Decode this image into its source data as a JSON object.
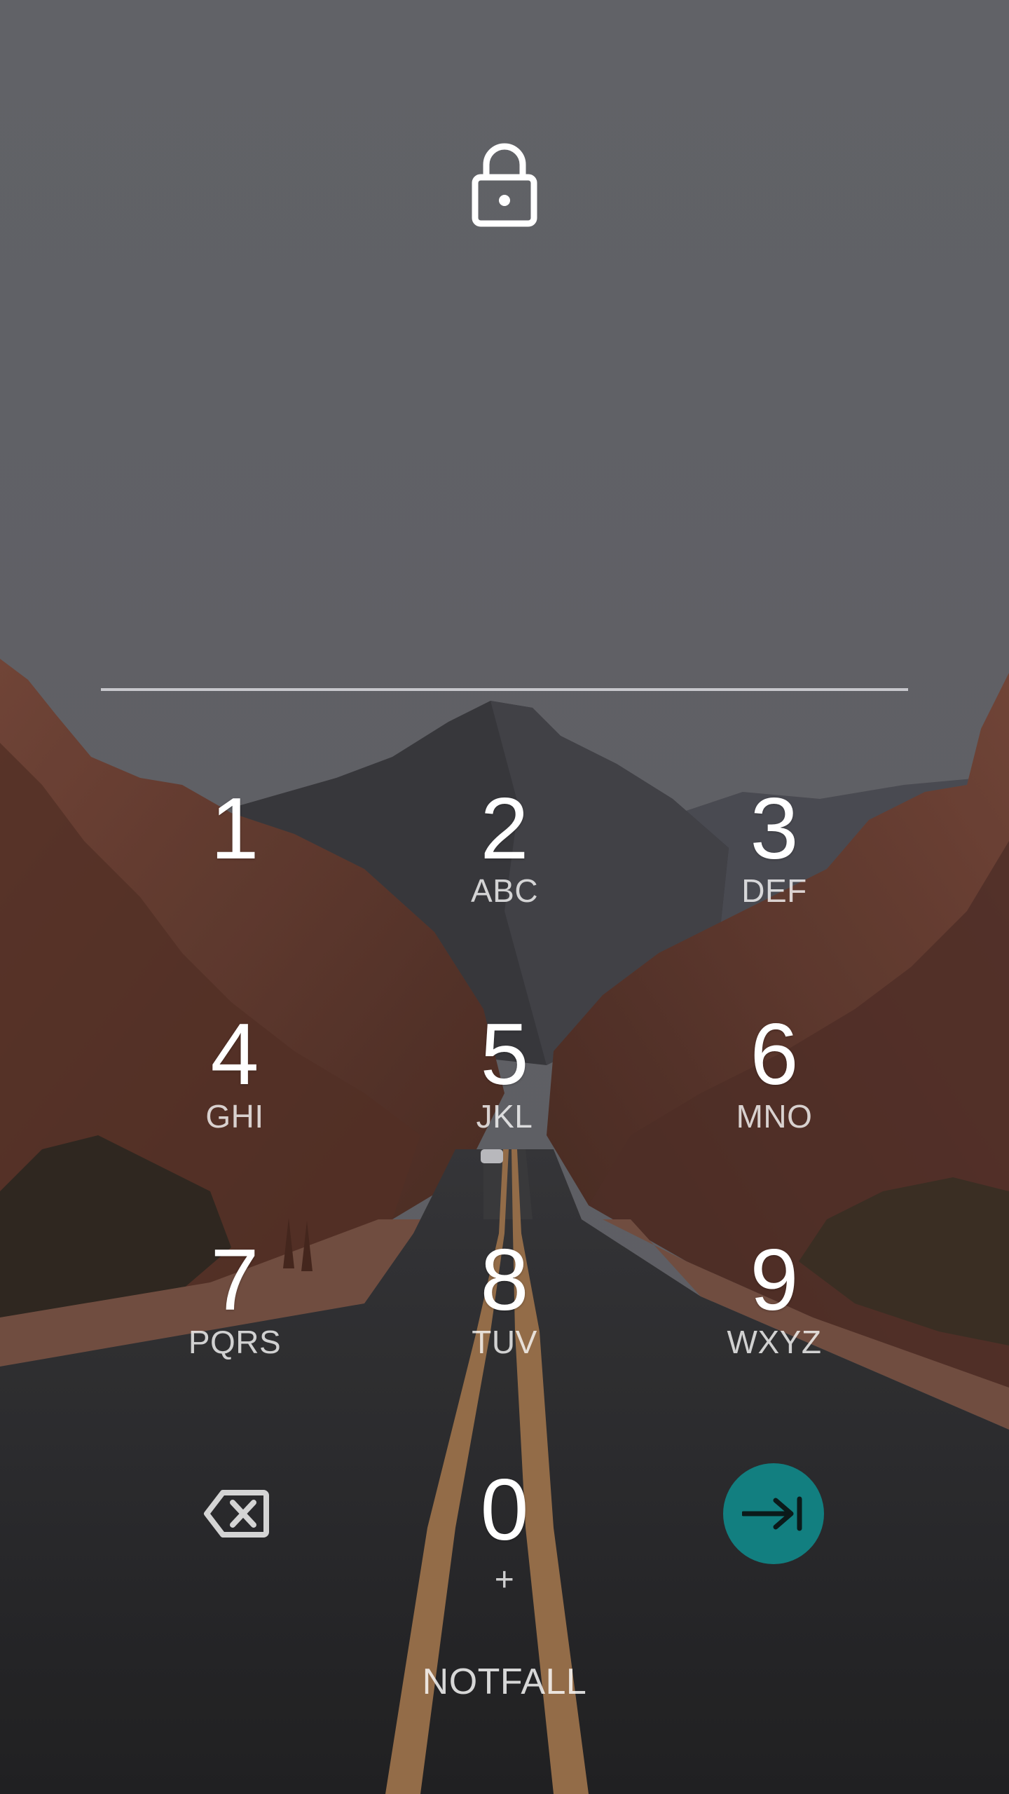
{
  "lock_screen": {
    "lock_icon": "lock-icon",
    "keypad": [
      {
        "digit": "1",
        "letters": ""
      },
      {
        "digit": "2",
        "letters": "ABC"
      },
      {
        "digit": "3",
        "letters": "DEF"
      },
      {
        "digit": "4",
        "letters": "GHI"
      },
      {
        "digit": "5",
        "letters": "JKL"
      },
      {
        "digit": "6",
        "letters": "MNO"
      },
      {
        "digit": "7",
        "letters": "PQRS"
      },
      {
        "digit": "8",
        "letters": "TUV"
      },
      {
        "digit": "9",
        "letters": "WXYZ"
      },
      {
        "digit": "0",
        "letters": "+"
      }
    ],
    "backspace_icon": "backspace-icon",
    "enter_icon": "enter-arrow-icon",
    "emergency_label": "NOTFALL"
  },
  "colors": {
    "enter_button": "#127f80",
    "text": "#ffffff"
  }
}
